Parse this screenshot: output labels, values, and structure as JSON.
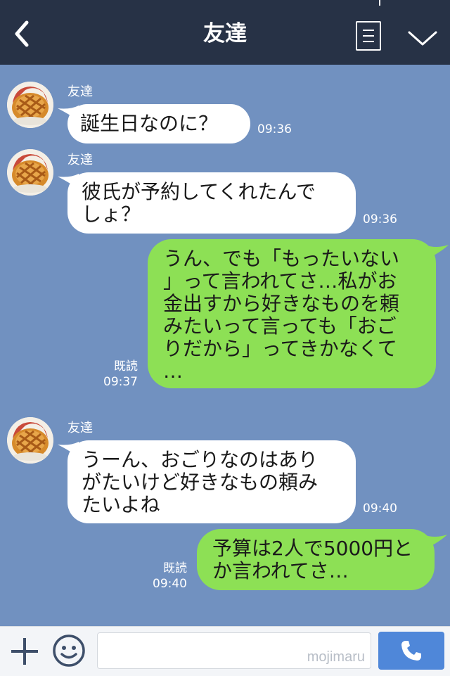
{
  "header": {
    "title": "友達",
    "back_icon": "chevron-left-icon",
    "menu_icon": "menu-list-icon",
    "collapse_icon": "chevron-down-icon"
  },
  "messages": [
    {
      "direction": "incoming",
      "sender": "友達",
      "text": "誕生日なのに？",
      "time": "09:36"
    },
    {
      "direction": "incoming",
      "sender": "友達",
      "text": "彼氏が予約してくれたんで\nしょ？",
      "time": "09:36"
    },
    {
      "direction": "outgoing",
      "read": "既読",
      "text": "うん、でも「もったいない\n」って言われてさ…私がお\n金出すから好きなものを頼\nみたいって言っても「おご\nりだから」ってきかなくて\n…",
      "time": "09:37"
    },
    {
      "direction": "incoming",
      "sender": "友達",
      "text": "うーん、おごりなのはあり\nがたいけど好きなもの頼み\nたいよね",
      "time": "09:40"
    },
    {
      "direction": "outgoing",
      "read": "既読",
      "text": "予算は2人で5000円と\nか言われてさ…",
      "time": "09:40"
    }
  ],
  "input_bar": {
    "plus_icon": "plus-icon",
    "emoji_icon": "smiley-icon",
    "placeholder": "",
    "watermark": "mojimaru",
    "send_icon": "phone-icon"
  },
  "colors": {
    "header_bg": "#273246",
    "chat_bg": "#7191c0",
    "incoming_bubble": "#ffffff",
    "outgoing_bubble": "#8de055",
    "send_button": "#4f87d9"
  }
}
